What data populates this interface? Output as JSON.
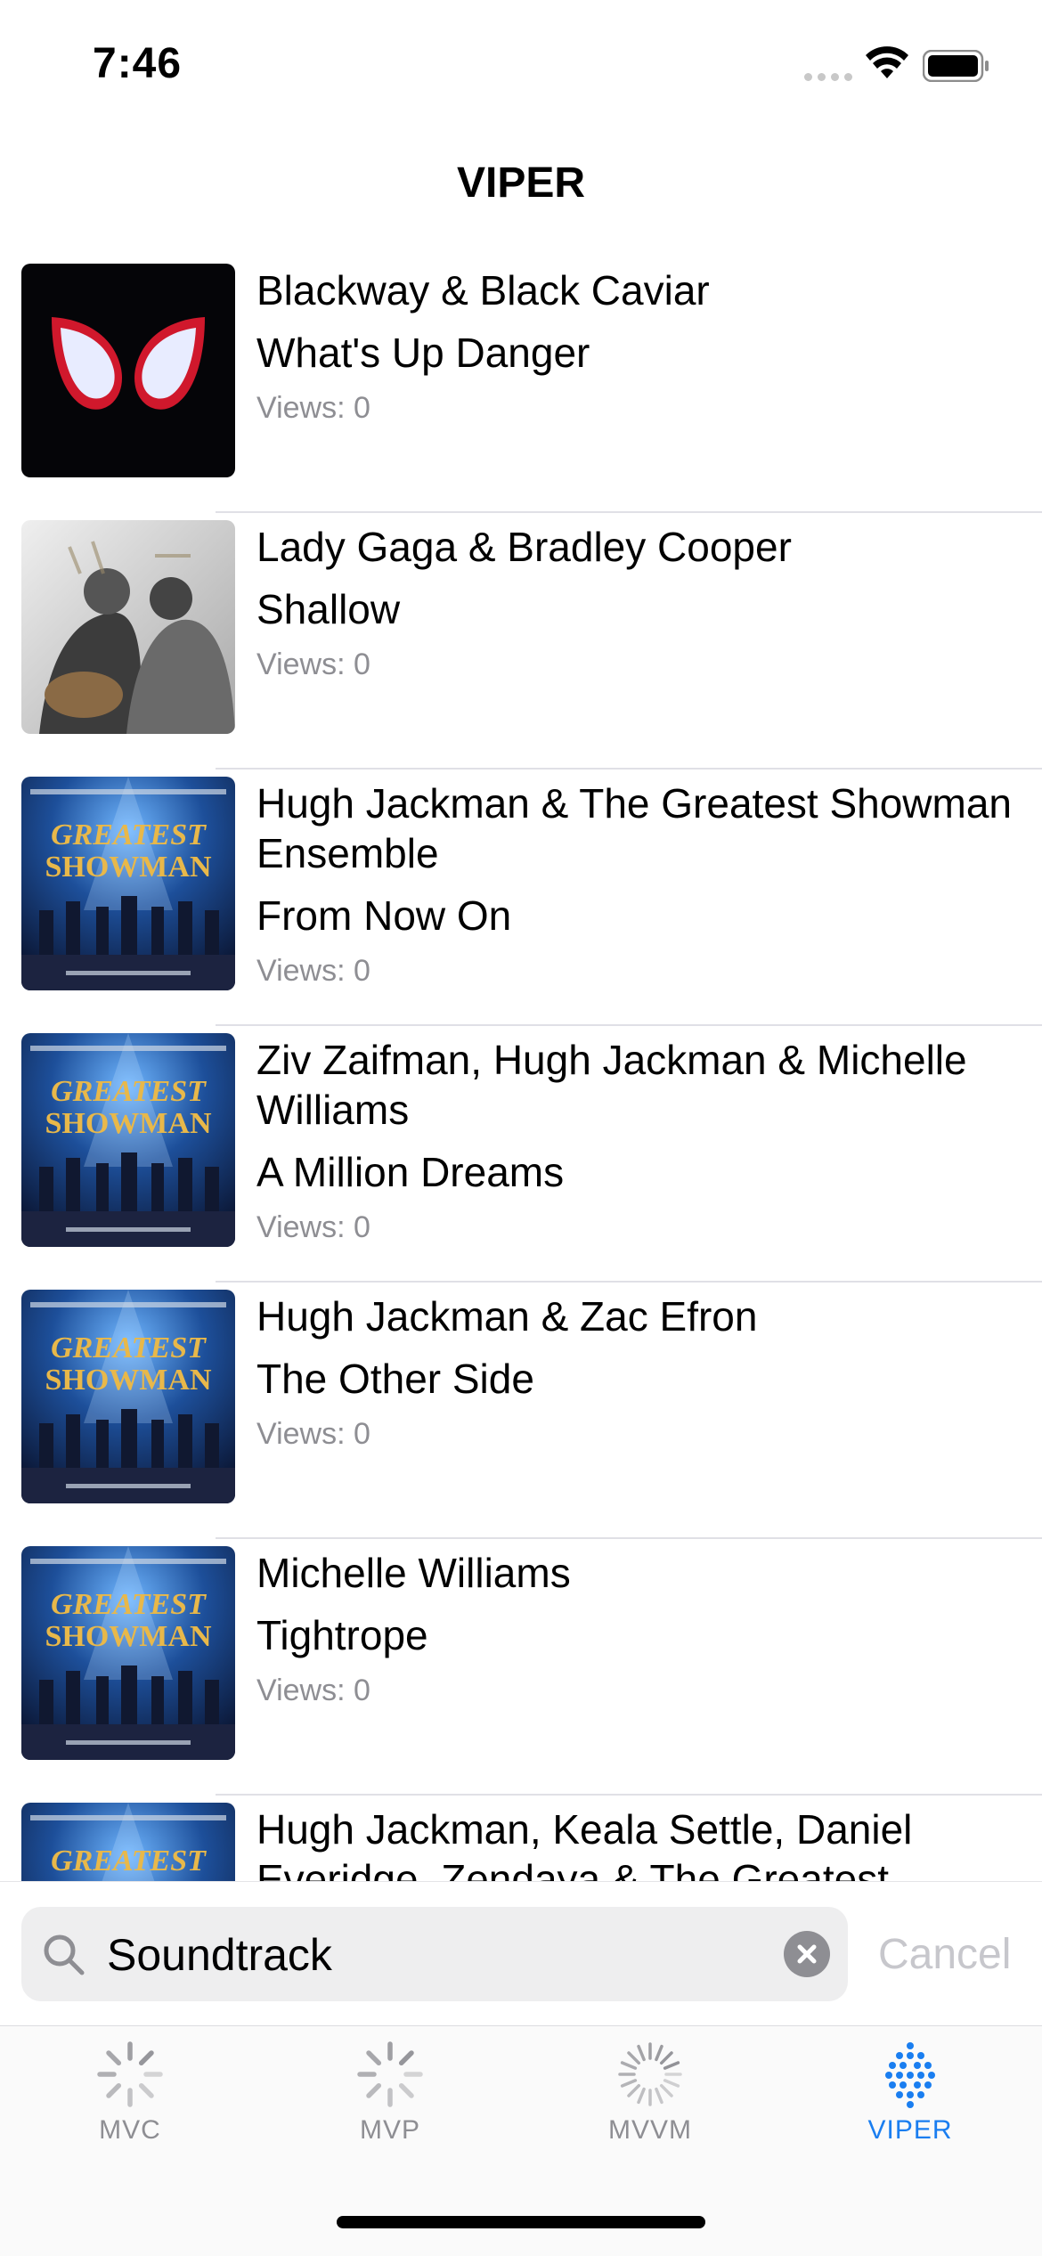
{
  "status_bar": {
    "time": "7:46"
  },
  "nav": {
    "title": "VIPER"
  },
  "tracks": [
    {
      "artist": "Blackway & Black Caviar",
      "title": "What's Up Danger",
      "views": "Views: 0",
      "art": "spider-verse-mask"
    },
    {
      "artist": "Lady Gaga & Bradley Cooper",
      "title": "Shallow",
      "views": "Views: 0",
      "art": "a-star-is-born"
    },
    {
      "artist": "Hugh Jackman & The Greatest Showman Ensemble",
      "title": "From Now On",
      "views": "Views: 0",
      "art": "greatest-showman"
    },
    {
      "artist": "Ziv Zaifman, Hugh Jackman & Michelle Williams",
      "title": "A Million Dreams",
      "views": "Views: 0",
      "art": "greatest-showman"
    },
    {
      "artist": "Hugh Jackman & Zac Efron",
      "title": "The Other Side",
      "views": "Views: 0",
      "art": "greatest-showman"
    },
    {
      "artist": "Michelle Williams",
      "title": "Tightrope",
      "views": "Views: 0",
      "art": "greatest-showman"
    },
    {
      "artist": "Hugh Jackman, Keala Settle, Daniel Everidge, Zendaya & The Greatest Showman Ensemble",
      "title": "",
      "views": "",
      "art": "greatest-showman"
    }
  ],
  "search": {
    "value": "Soundtrack",
    "cancel_label": "Cancel"
  },
  "tabs": [
    {
      "label": "MVC",
      "icon": "spinner-icon",
      "active": false
    },
    {
      "label": "MVP",
      "icon": "spinner-icon",
      "active": false
    },
    {
      "label": "MVVM",
      "icon": "spinner-icon",
      "active": false
    },
    {
      "label": "VIPER",
      "icon": "dots-grid-icon",
      "active": true
    }
  ],
  "colors": {
    "accent": "#1a7ef0",
    "inactive": "#8e8e93",
    "separator": "#e0e0e6"
  }
}
